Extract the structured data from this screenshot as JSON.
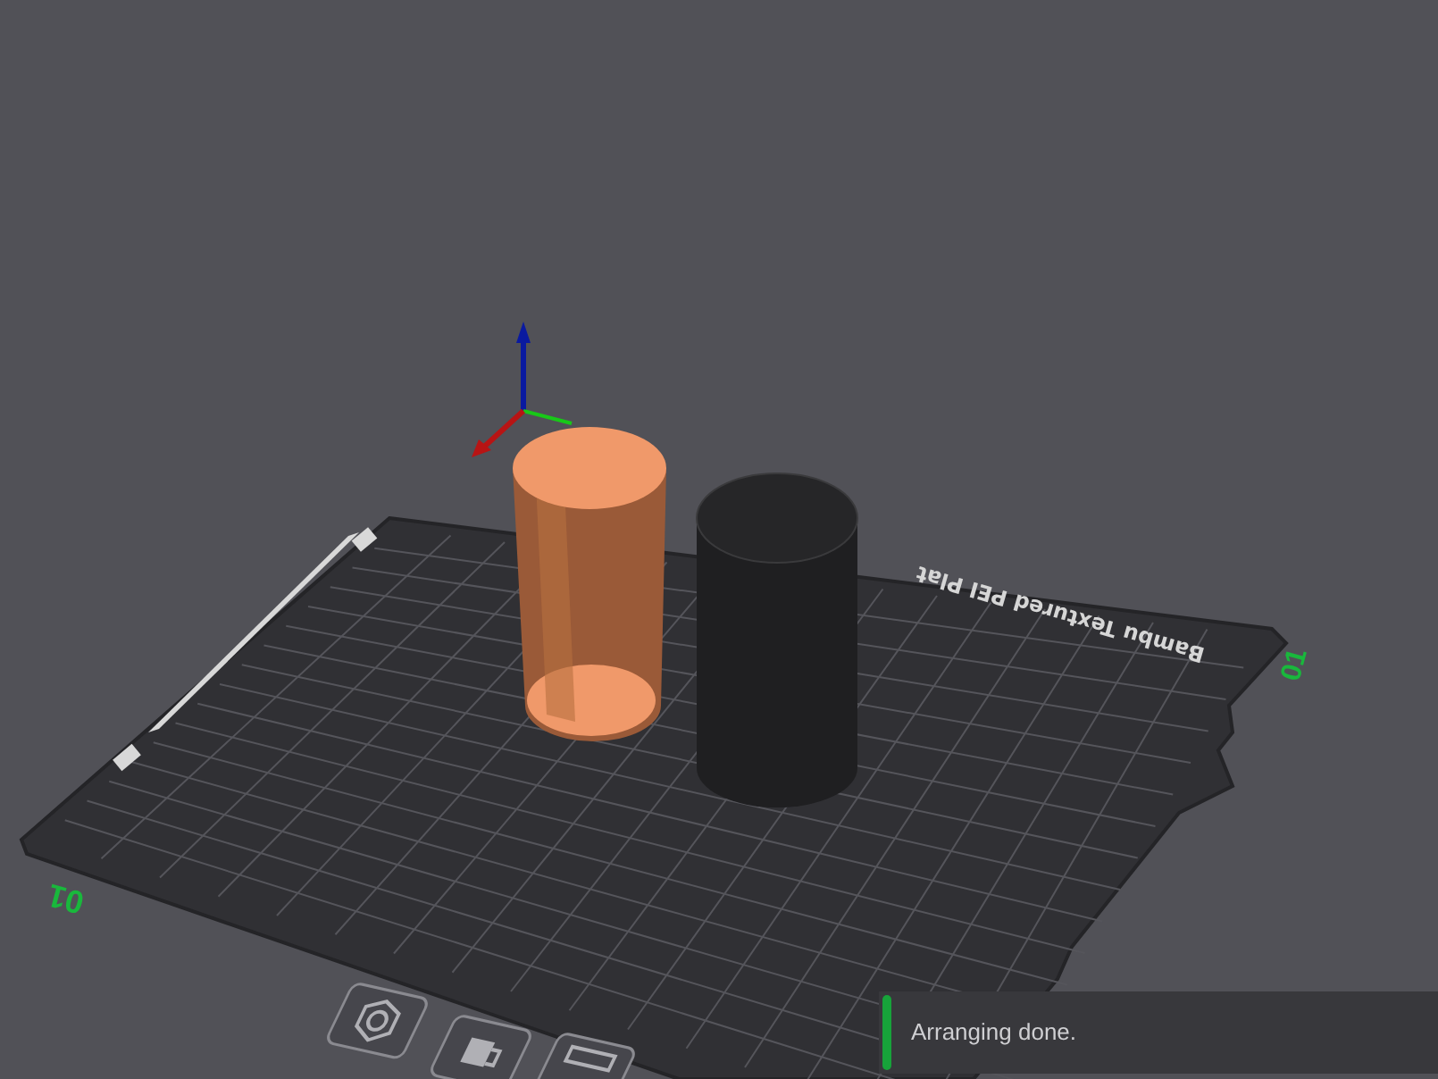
{
  "plate": {
    "name": "Bambu Textured PEI Plat",
    "labels": [
      "01",
      "01"
    ]
  },
  "notification": {
    "text": "Arranging done."
  }
}
